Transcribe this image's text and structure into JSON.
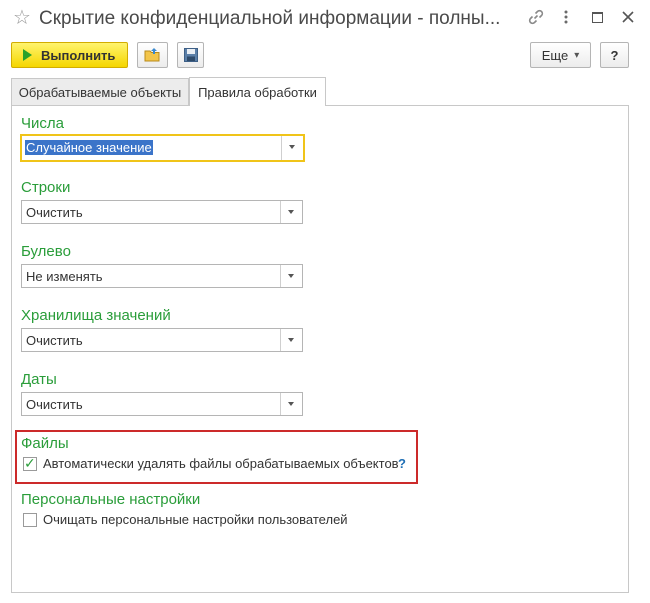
{
  "window": {
    "title": "Скрытие конфиденциальной информации - полны...",
    "star_icon": "☆",
    "link_icon": "🔗",
    "more_icon": "⋮",
    "maximize_icon": "☐",
    "close_icon": "✕"
  },
  "toolbar": {
    "run_label": "Выполнить",
    "more_label": "Еще",
    "more_arrow": "▾",
    "help_label": "?"
  },
  "tabs": [
    {
      "label": "Обрабатываемые объекты",
      "active": false
    },
    {
      "label": "Правила обработки",
      "active": true
    }
  ],
  "form": {
    "numbers": {
      "label": "Числа",
      "value": "Случайное значение"
    },
    "strings": {
      "label": "Строки",
      "value": "Очистить"
    },
    "boolean": {
      "label": "Булево",
      "value": "Не изменять"
    },
    "value_storage": {
      "label": "Хранилища значений",
      "value": "Очистить"
    },
    "dates": {
      "label": "Даты",
      "value": "Очистить"
    },
    "files": {
      "label": "Файлы",
      "checkbox_label": "Автоматически удалять файлы обрабатываемых объектов",
      "checked": true,
      "check_mark": "✓",
      "help": "?"
    },
    "personal": {
      "label": "Персональные настройки",
      "checkbox_label": "Очищать персональные настройки пользователей",
      "checked": false
    }
  },
  "colors": {
    "section_title": "#2a9d3a",
    "run_button": "#f5d600",
    "highlight_border": "#cc2a2a",
    "focus_border": "#f0c419",
    "selection": "#3b74c9"
  }
}
